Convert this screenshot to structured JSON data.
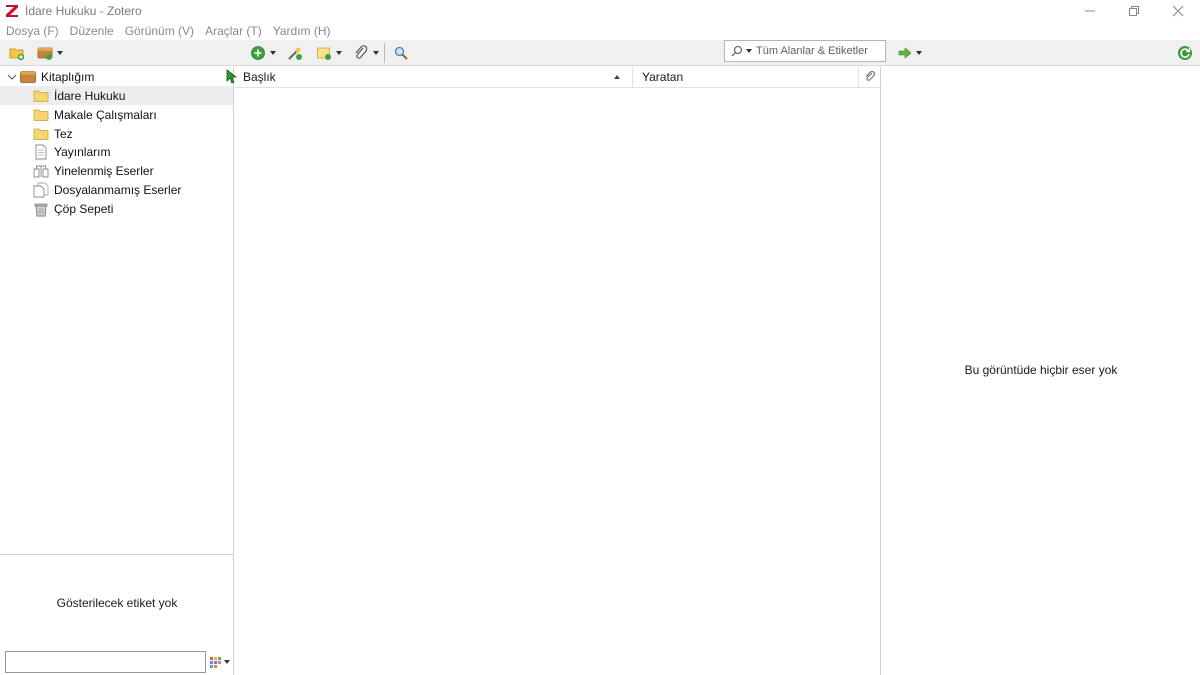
{
  "window": {
    "title": "İdare Hukuku - Zotero"
  },
  "menu": {
    "items": [
      "Dosya (F)",
      "Düzenle",
      "Görünüm (V)",
      "Araçlar (T)",
      "Yardım (H)"
    ]
  },
  "toolbar": {
    "search_placeholder": "Tüm Alanlar & Etiketler"
  },
  "collections": {
    "library": "Kitaplığım",
    "items": [
      {
        "label": "İdare Hukuku",
        "icon": "folder-icon",
        "selected": true
      },
      {
        "label": "Makale Çalışmaları",
        "icon": "folder-icon",
        "selected": false
      },
      {
        "label": "Tez",
        "icon": "folder-icon",
        "selected": false
      },
      {
        "label": "Yayınlarım",
        "icon": "document-icon",
        "selected": false
      },
      {
        "label": "Yinelenmiş Eserler",
        "icon": "duplicate-icon",
        "selected": false
      },
      {
        "label": "Dosyalanmamış Eserler",
        "icon": "unfiled-icon",
        "selected": false
      },
      {
        "label": "Çöp Sepeti",
        "icon": "trash-icon",
        "selected": false
      }
    ]
  },
  "tags": {
    "empty_message": "Gösterilecek etiket yok",
    "filter_value": ""
  },
  "items_table": {
    "columns": {
      "title": "Başlık",
      "creator": "Yaratan"
    },
    "sort_column": "title",
    "sort_direction": "ascending"
  },
  "item_pane": {
    "empty_message": "Bu görüntüde hiçbir eser yok"
  },
  "colors": {
    "logo_red": "#c8102e",
    "folder_yellow": "#f5c84a",
    "add_green": "#3da13d",
    "sync_green": "#3a9a3a",
    "selection_bg": "#eeeeee"
  }
}
